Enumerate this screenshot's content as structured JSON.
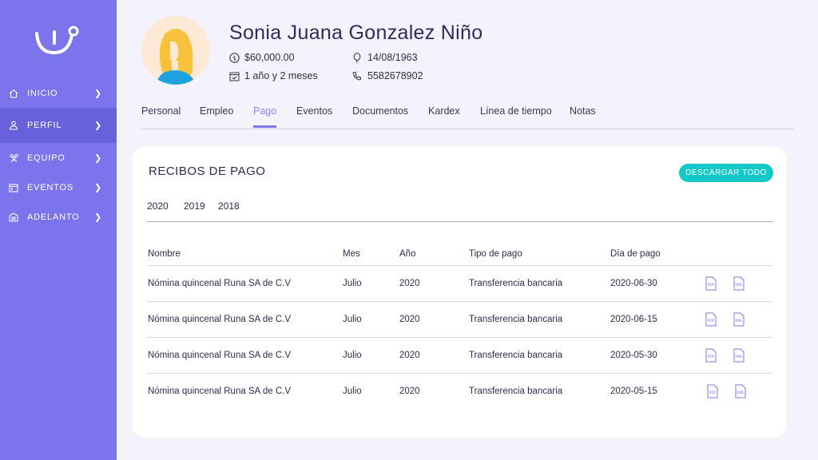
{
  "sidebar": {
    "items": [
      {
        "label": "INICIO",
        "icon": "home-icon",
        "active": false
      },
      {
        "label": "PERFIL",
        "icon": "user-icon",
        "active": true
      },
      {
        "label": "EQUIPO",
        "icon": "team-icon",
        "active": false
      },
      {
        "label": "EVENTOS",
        "icon": "calendar-icon",
        "active": false
      },
      {
        "label": "ADELANTO",
        "icon": "building-icon",
        "active": false
      }
    ]
  },
  "profile": {
    "name": "Sonia Juana Gonzalez Niño",
    "salary": "$60,000.00",
    "tenure": "1 año y 2 meses",
    "birthdate": "14/08/1963",
    "phone": "5582678902"
  },
  "tabs": [
    "Personal",
    "Empleo",
    "Pago",
    "Eventos",
    "Documentos",
    "Kardex",
    "Línea de tiempo",
    "Notas"
  ],
  "active_tab": "Pago",
  "card": {
    "title": "RECIBOS DE PAGO",
    "download_label": "DESCARGAR TODO",
    "years": [
      "2020",
      "2019",
      "2018"
    ]
  },
  "table": {
    "headers": [
      "Nombre",
      "Mes",
      "Año",
      "Tipo de pago",
      "Día de pago"
    ],
    "rows": [
      [
        "Nómina quincenal Runa SA de C.V",
        "Julio",
        "2020",
        "Transferencia bancaria",
        "2020-06-30"
      ],
      [
        "Nómina quincenal Runa SA de C.V",
        "Julio",
        "2020",
        "Transferencia bancaria",
        "2020-06-15"
      ],
      [
        "Nómina quincenal Runa SA de C.V",
        "Julio",
        "2020",
        "Transferencia bancaria",
        "2020-05-30"
      ],
      [
        "Nómina quincenal Runa SA de C.V",
        "Julio",
        "2020",
        "Transferencia bancaria",
        "2020-05-15"
      ]
    ]
  },
  "colors": {
    "sidebar": "#7b74ec",
    "sidebar_active": "#6861dc",
    "accent": "#13c8c9",
    "tab_active": "#8a84f0"
  }
}
